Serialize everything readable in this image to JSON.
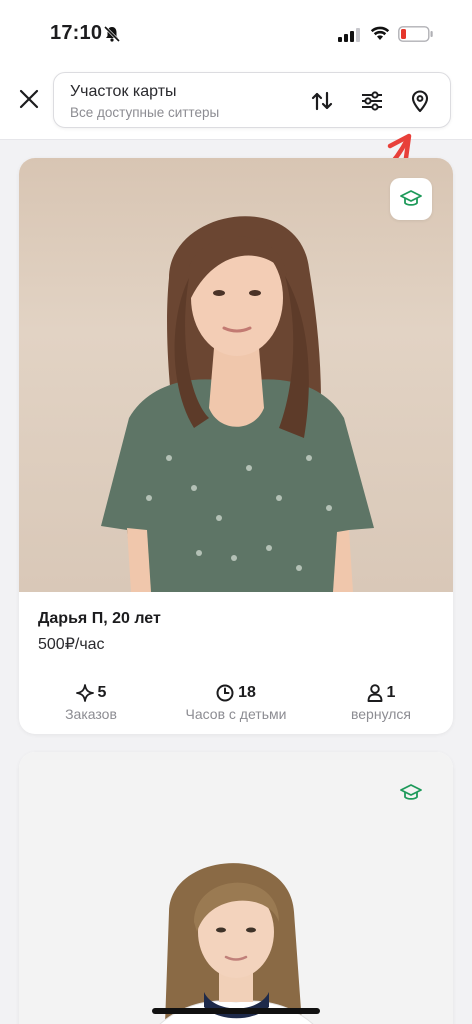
{
  "status_bar": {
    "time": "17:10"
  },
  "header": {
    "search_title": "Участок карты",
    "search_subtitle": "Все доступные ситтеры",
    "icons": [
      "close-icon",
      "sort-icon",
      "filter-icon",
      "map-pin-icon"
    ]
  },
  "colors": {
    "accent_green": "#1e9a5a",
    "annotation_red": "#e8403a",
    "battery_red": "#e5362b"
  },
  "cards": [
    {
      "name": "Дарья П, 20 лет",
      "rate": "500₽/час",
      "stats": [
        {
          "icon": "sparkle-icon",
          "value": "5",
          "label": "Заказов"
        },
        {
          "icon": "clock-icon",
          "value": "18",
          "label": "Часов с детьми"
        },
        {
          "icon": "person-icon",
          "value": "1",
          "label": "вернулся"
        }
      ]
    }
  ]
}
